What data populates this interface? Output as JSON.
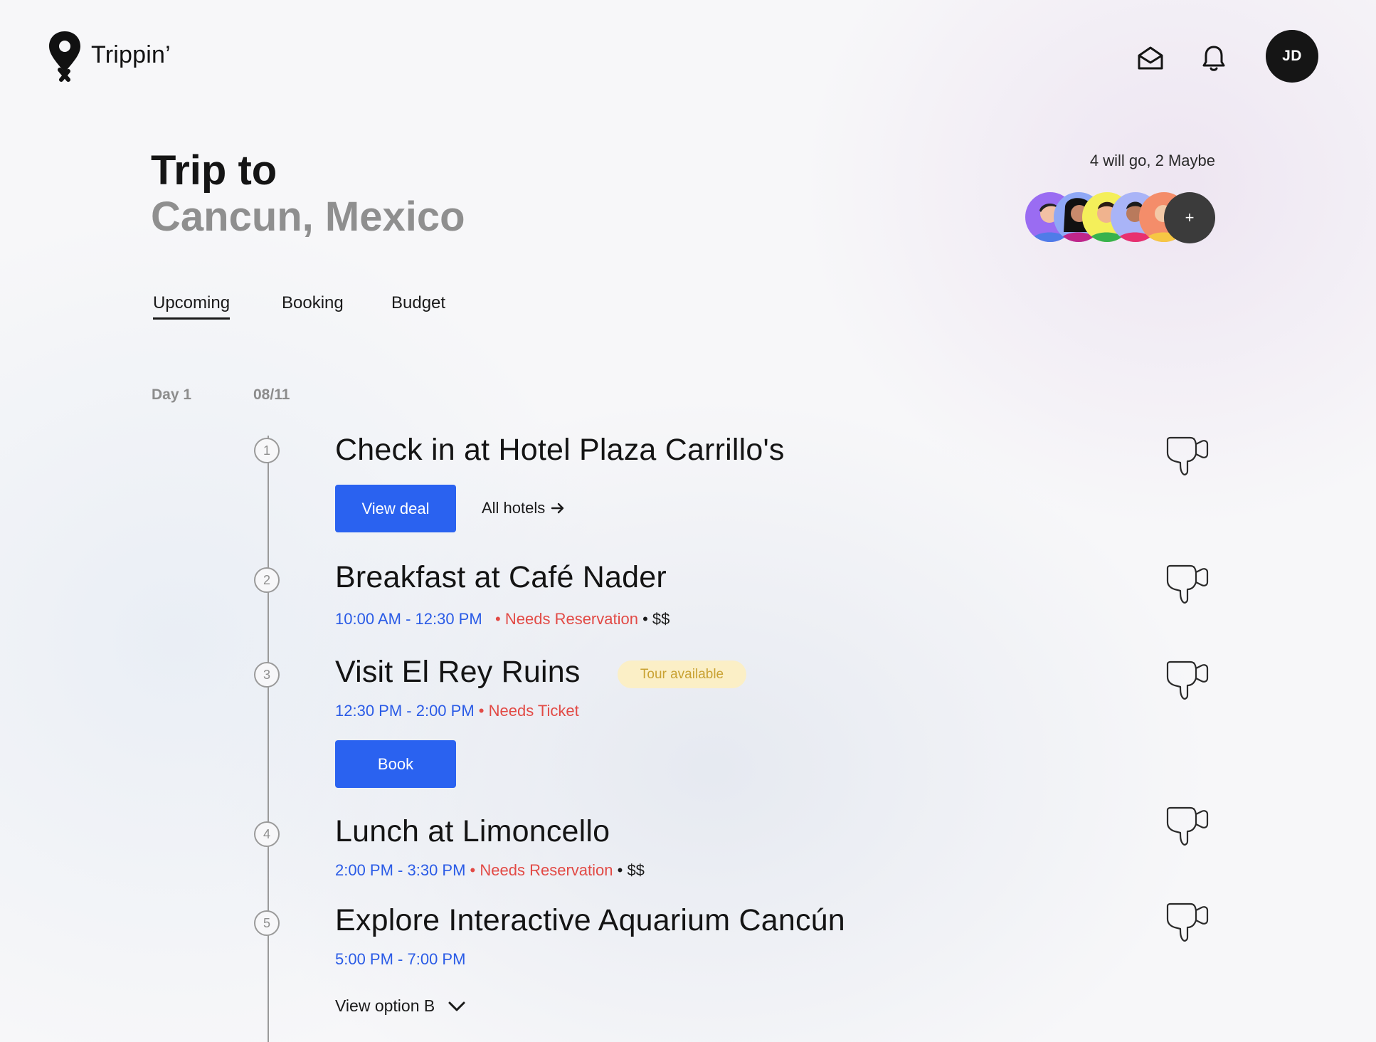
{
  "app": {
    "name": "Trippin’"
  },
  "header": {
    "mail_icon": "mail-open-icon",
    "bell_icon": "bell-icon",
    "user_initials": "JD"
  },
  "trip": {
    "title_line1": "Trip to",
    "title_line2": "Cancun, Mexico",
    "rsvp_summary": "4 will go, 2 Maybe",
    "more_attendees_label": "+"
  },
  "tabs": [
    {
      "label": "Upcoming",
      "active": true
    },
    {
      "label": "Booking",
      "active": false
    },
    {
      "label": "Budget",
      "active": false
    }
  ],
  "day": {
    "label": "Day 1",
    "date": "08/11"
  },
  "items": [
    {
      "number": "1",
      "title": "Check in at Hotel Plaza Carrillo's",
      "primary_action": "View deal",
      "secondary_action": "All hotels"
    },
    {
      "number": "2",
      "title": "Breakfast at Café Nader",
      "time": "10:00 AM - 12:30 PM",
      "status": "Needs Reservation",
      "price": "$$"
    },
    {
      "number": "3",
      "title": "Visit El Rey Ruins",
      "badge": "Tour available",
      "time": "12:30 PM - 2:00 PM",
      "status": "Needs Ticket",
      "primary_action": "Book"
    },
    {
      "number": "4",
      "title": "Lunch at Limoncello",
      "time": "2:00 PM - 3:30 PM",
      "status": "Needs Reservation",
      "price": "$$"
    },
    {
      "number": "5",
      "title": "Explore Interactive Aquarium Cancún",
      "time": "5:00 PM - 7:00 PM",
      "more_option": "View option B"
    }
  ],
  "colors": {
    "accent_blue": "#2a62f0",
    "time_blue": "#2a5be6",
    "warning_red": "#e24a45",
    "badge_bg": "#fbefc6",
    "badge_text": "#c9a233"
  }
}
